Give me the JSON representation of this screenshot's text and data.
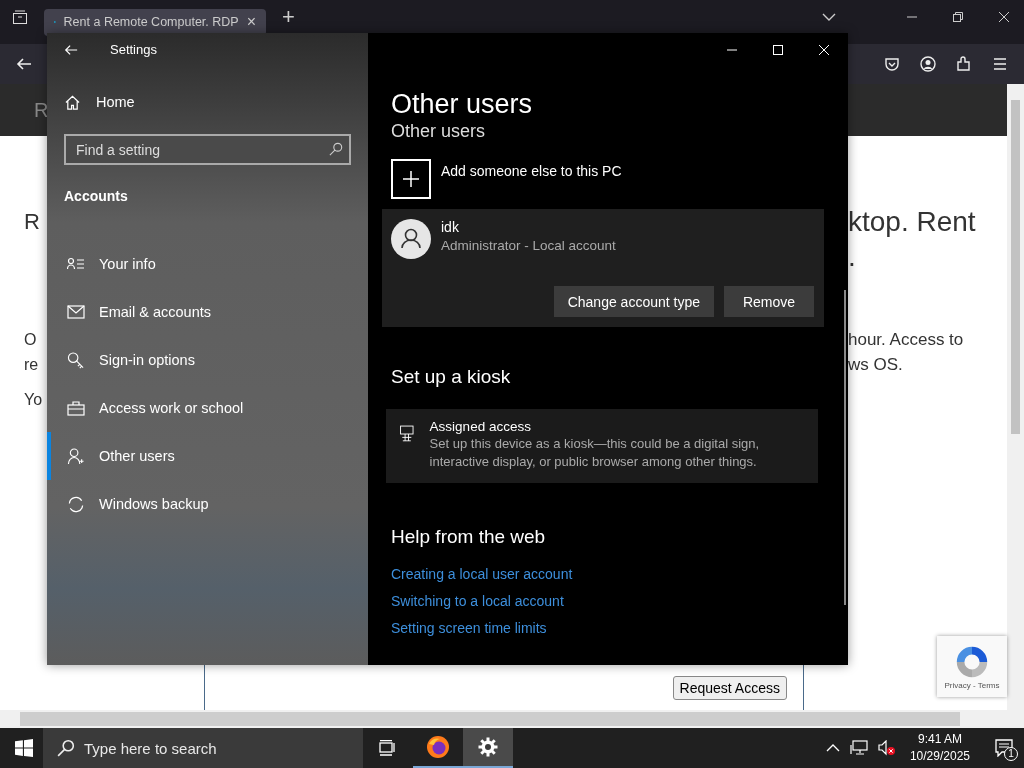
{
  "browser": {
    "tab": {
      "title": "Rent a Remote Computer. RDP",
      "close": "×"
    },
    "new_tab": "+",
    "page": {
      "header_text": "R",
      "left_fragments": [
        {
          "text": "R",
          "kind": "heading"
        },
        {
          "text": "O",
          "kind": "body"
        },
        {
          "text": "re",
          "kind": "body"
        },
        {
          "text": "Yo",
          "kind": "body"
        }
      ],
      "right_fragments": [
        {
          "text": "ktop. Rent",
          "kind": "heading"
        },
        {
          "text": ".",
          "kind": "heading"
        },
        {
          "text": "hour. Access to",
          "kind": "body"
        },
        {
          "text": "ws OS.",
          "kind": "body"
        }
      ],
      "request_button": "Request Access",
      "recaptcha": "Privacy - Terms"
    }
  },
  "settings": {
    "title": "Settings",
    "home": "Home",
    "search": {
      "placeholder": "Find a setting"
    },
    "section": "Accounts",
    "nav": [
      {
        "label": "Your info",
        "kind": "info",
        "selected": false
      },
      {
        "label": "Email & accounts",
        "kind": "mail",
        "selected": false
      },
      {
        "label": "Sign-in options",
        "kind": "key",
        "selected": false
      },
      {
        "label": "Access work or school",
        "kind": "briefcase",
        "selected": false
      },
      {
        "label": "Other users",
        "kind": "person",
        "selected": true
      },
      {
        "label": "Windows backup",
        "kind": "sync",
        "selected": false
      }
    ],
    "heading": "Other users",
    "subheading": "Other users",
    "add_user": "Add someone else to this PC",
    "user": {
      "name": "idk",
      "role": "Administrator - Local account",
      "buttons": [
        "Change account type",
        "Remove"
      ]
    },
    "kiosk_title": "Set up a kiosk",
    "kiosk": {
      "title": "Assigned access",
      "description": "Set up this device as a kiosk—this could be a digital sign, interactive display, or public browser among other things."
    },
    "help_title": "Help from the web",
    "links": [
      "Creating a local user account",
      "Switching to a local account",
      "Setting screen time limits"
    ]
  },
  "taskbar": {
    "search": {
      "placeholder": "Type here to search"
    },
    "apps": [
      {
        "kind": "taskview",
        "running": false,
        "selected": false
      },
      {
        "kind": "firefox",
        "running": true,
        "selected": false
      },
      {
        "kind": "settings",
        "running": true,
        "selected": true
      }
    ],
    "time": "9:41 AM",
    "date": "10/29/2025",
    "notifications": "1"
  }
}
